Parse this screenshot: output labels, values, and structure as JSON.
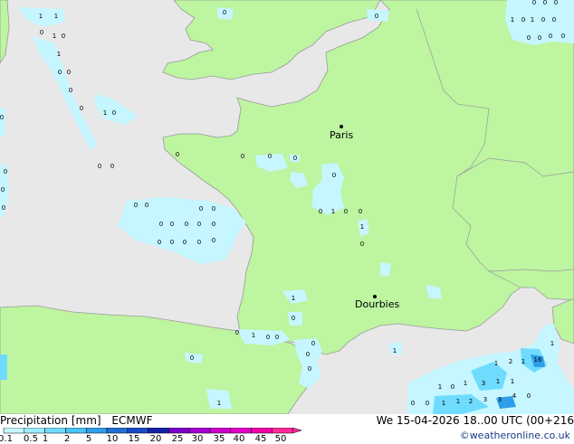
{
  "map": {
    "cities": [
      {
        "name": "Paris"
      },
      {
        "name": "Dourbies"
      }
    ],
    "values": [
      "1",
      "1",
      "0",
      "1",
      "0",
      "1",
      "0",
      "0",
      "0",
      "0",
      "1",
      "0",
      "0",
      "0",
      "0",
      "0",
      "0",
      "0",
      "0",
      "0",
      "0",
      "0",
      "0",
      "0",
      "1",
      "0",
      "0",
      "0",
      "0",
      "1",
      "0",
      "0",
      "0",
      "0",
      "0",
      "0",
      "0",
      "0",
      "0",
      "0",
      "0",
      "0",
      "1",
      "0",
      "0",
      "0",
      "0",
      "0",
      "1",
      "0",
      "0",
      "0",
      "0",
      "0",
      "0",
      "0",
      "0",
      "1",
      "0",
      "1",
      "0",
      "0",
      "0",
      "0",
      "0",
      "0",
      "1",
      "0",
      "1",
      "1",
      "0",
      "0",
      "0",
      "1",
      "1",
      "3",
      "1",
      "1",
      "1",
      "2",
      "3",
      "3",
      "4",
      "0",
      "2",
      "1",
      "16",
      "1",
      "1"
    ]
  },
  "legend": {
    "title": "Precipitation [mm]",
    "model": "ECMWF",
    "ticks": [
      "0.1",
      "0.5",
      "1",
      "2",
      "5",
      "10",
      "15",
      "20",
      "25",
      "30",
      "35",
      "40",
      "45",
      "50"
    ],
    "colors": [
      "#c6f6ff",
      "#9beeff",
      "#6fdcff",
      "#46c4f4",
      "#2f9ee8",
      "#1f6fd6",
      "#1b48c4",
      "#1420a8",
      "#7a00c8",
      "#a800d4",
      "#cc00cc",
      "#e400c8",
      "#f000a8",
      "#ff2a9c"
    ]
  },
  "footer": {
    "datetime": "We 15-04-2026 18..00 UTC (00+216",
    "credit": "©weatheronline.co.uk"
  },
  "colors": {
    "land": "#bdf5a0",
    "sea": "#e8e8e8",
    "border": "#9a9a9a",
    "precip_light": "#c6f6ff",
    "precip_med": "#6fdcff"
  }
}
